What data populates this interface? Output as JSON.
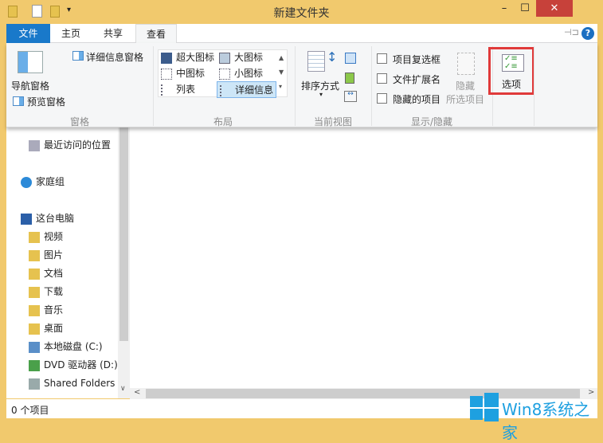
{
  "window": {
    "title": "新建文件夹",
    "minimize": "–",
    "maximize": "☐",
    "close": "✕"
  },
  "tabs": [
    {
      "label": "文件"
    },
    {
      "label": "主页"
    },
    {
      "label": "共享"
    },
    {
      "label": "查看"
    }
  ],
  "ribbon": {
    "panes": {
      "nav_pane": "导航窗格",
      "preview_pane": "预览窗格",
      "details_pane": "详细信息窗格",
      "group": "窗格"
    },
    "layout": {
      "items": [
        "超大图标",
        "大图标",
        "中图标",
        "小图标",
        "列表",
        "详细信息"
      ],
      "selected": "详细信息",
      "group": "布局"
    },
    "current_view": {
      "sort": "排序方式",
      "group": "当前视图"
    },
    "show_hide": {
      "checkboxes": [
        {
          "label": "项目复选框",
          "checked": false
        },
        {
          "label": "文件扩展名",
          "checked": false
        },
        {
          "label": "隐藏的项目",
          "checked": false
        }
      ],
      "hide_selected_1": "隐藏",
      "hide_selected_2": "所选项目",
      "group": "显示/隐藏"
    },
    "options": {
      "label": "选项",
      "highlight_color": "#e03a3a"
    }
  },
  "nav": {
    "items": [
      "最近访问的位置",
      "家庭组",
      "这台电脑",
      "视频",
      "图片",
      "文档",
      "下载",
      "音乐",
      "桌面",
      "本地磁盘 (C:)",
      "DVD 驱动器 (D:)",
      "Shared Folders"
    ]
  },
  "status": {
    "count": "0 个项目"
  },
  "watermark": "Win8系统之家"
}
